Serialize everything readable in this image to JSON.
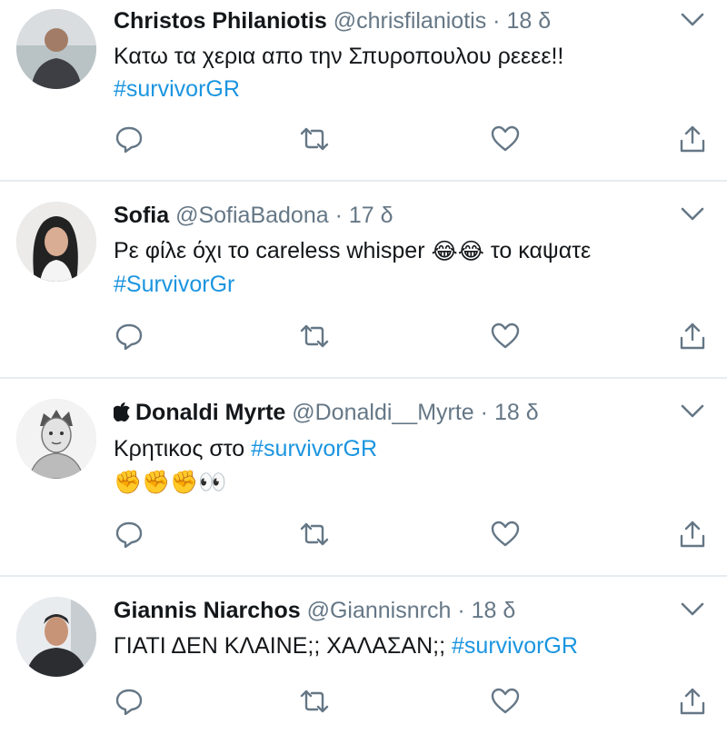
{
  "tweets": [
    {
      "name": "Christos Philaniotis",
      "handle": "@chrisfilaniotis",
      "separator": "·",
      "time": "18 δ",
      "text": "Κατω τα χερια απο την Σπυροπουλου ρεεεε!!",
      "hashtag": "#survivorGR"
    },
    {
      "name": "Sofia",
      "handle": "@SofiaBadona",
      "separator": "·",
      "time": "17 δ",
      "text_before": "Ρε φίλε όχι το careless whisper",
      "emojis": "😂😂",
      "text_after": "το καψατε",
      "hashtag": "#SurvivorGr"
    },
    {
      "name": "Donaldi Myrte",
      "handle": "@Donaldi__Myrte",
      "separator": "·",
      "time": "18 δ",
      "text": "Κρητικος στο",
      "hashtag": "#survivorGR",
      "emojis": "✊✊✊👀"
    },
    {
      "name": "Giannis Niarchos",
      "handle": "@Giannisnrch",
      "separator": "·",
      "time": "18 δ",
      "text": "ΓΙΑΤΙ ΔΕΝ ΚΛΑΙΝΕ;; ΧΑΛΑΣΑΝ;;",
      "hashtag": "#survivorGR"
    }
  ],
  "icons": {
    "reply": "reply-icon",
    "retweet": "retweet-icon",
    "like": "like-icon",
    "share": "share-icon",
    "more": "chevron-down-icon"
  },
  "colors": {
    "hashtag": "#1b95e0",
    "secondary_text": "#657786",
    "icon": "#657786",
    "divider": "#e6ecf0"
  }
}
